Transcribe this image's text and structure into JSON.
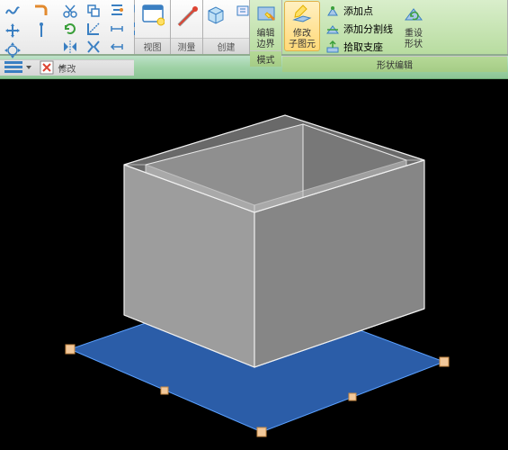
{
  "ribbon": {
    "panels": {
      "modify": {
        "title": "修改"
      },
      "view": {
        "title": "视图"
      },
      "measure": {
        "title": "测量"
      },
      "create": {
        "title": "创建"
      },
      "mode": {
        "title": "模式"
      },
      "edit_boundary": {
        "label_l1": "编辑",
        "label_l2": "边界"
      },
      "edit_subelem": {
        "label_l1": "修改",
        "label_l2": "子图元"
      },
      "shape_edit": {
        "title": "形状编辑",
        "add_point": "添加点",
        "add_split_line": "添加分割线",
        "pick_support": "拾取支座",
        "reset_l1": "重设",
        "reset_l2": "形状"
      }
    }
  },
  "lowerbar": {
    "b1": "rows-icon",
    "b2": "close-icon"
  }
}
